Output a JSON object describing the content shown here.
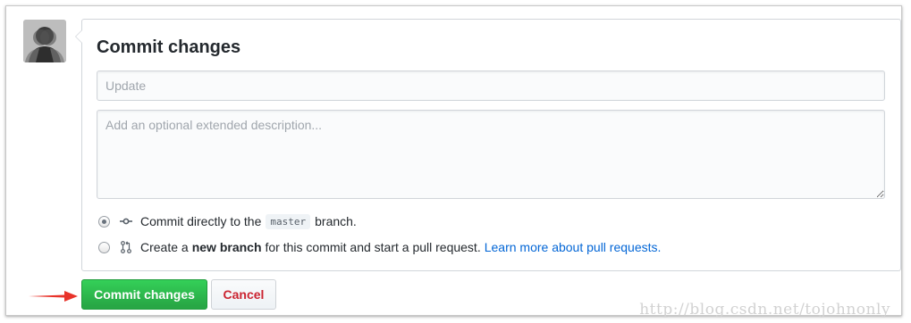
{
  "form": {
    "title": "Commit changes",
    "summary_placeholder": "Update",
    "description_placeholder": "Add an optional extended description..."
  },
  "options": {
    "direct": {
      "prefix": "Commit directly to the",
      "branch": "master",
      "suffix": "branch.",
      "selected": true
    },
    "new_branch": {
      "prefix": "Create a",
      "bold": "new branch",
      "suffix": "for this commit and start a pull request.",
      "link": "Learn more about pull requests.",
      "selected": false
    }
  },
  "buttons": {
    "commit": "Commit changes",
    "cancel": "Cancel"
  },
  "watermark": "http://blog.csdn.net/tojohnonly",
  "icons": [
    "avatar",
    "git-commit-icon",
    "git-pull-request-icon",
    "red-arrow-icon"
  ],
  "colors": {
    "commit_button": "#28a745",
    "cancel_text": "#cb2431",
    "link": "#0366d6",
    "arrow": "#e8332a"
  }
}
